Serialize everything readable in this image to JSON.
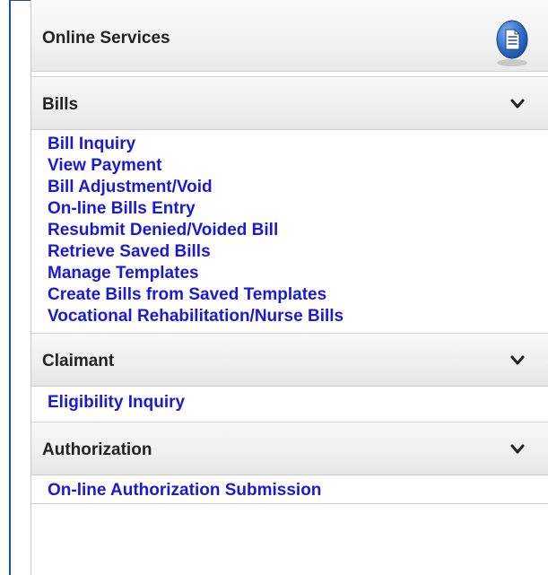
{
  "panel": {
    "title": "Online Services",
    "icon": "document-icon"
  },
  "sections": [
    {
      "title": "Bills",
      "links": [
        "Bill Inquiry",
        "View Payment",
        "Bill Adjustment/Void",
        "On-line Bills Entry",
        "Resubmit Denied/Voided Bill",
        "Retrieve Saved Bills",
        "Manage Templates",
        "Create Bills from Saved Templates",
        "Vocational Rehabilitation/Nurse Bills"
      ]
    },
    {
      "title": "Claimant",
      "links": [
        "Eligibility Inquiry"
      ]
    },
    {
      "title": "Authorization",
      "links": [
        "On-line Authorization Submission"
      ]
    }
  ],
  "colors": {
    "link": "#1a1ad6",
    "frame": "#1f4f9e"
  }
}
